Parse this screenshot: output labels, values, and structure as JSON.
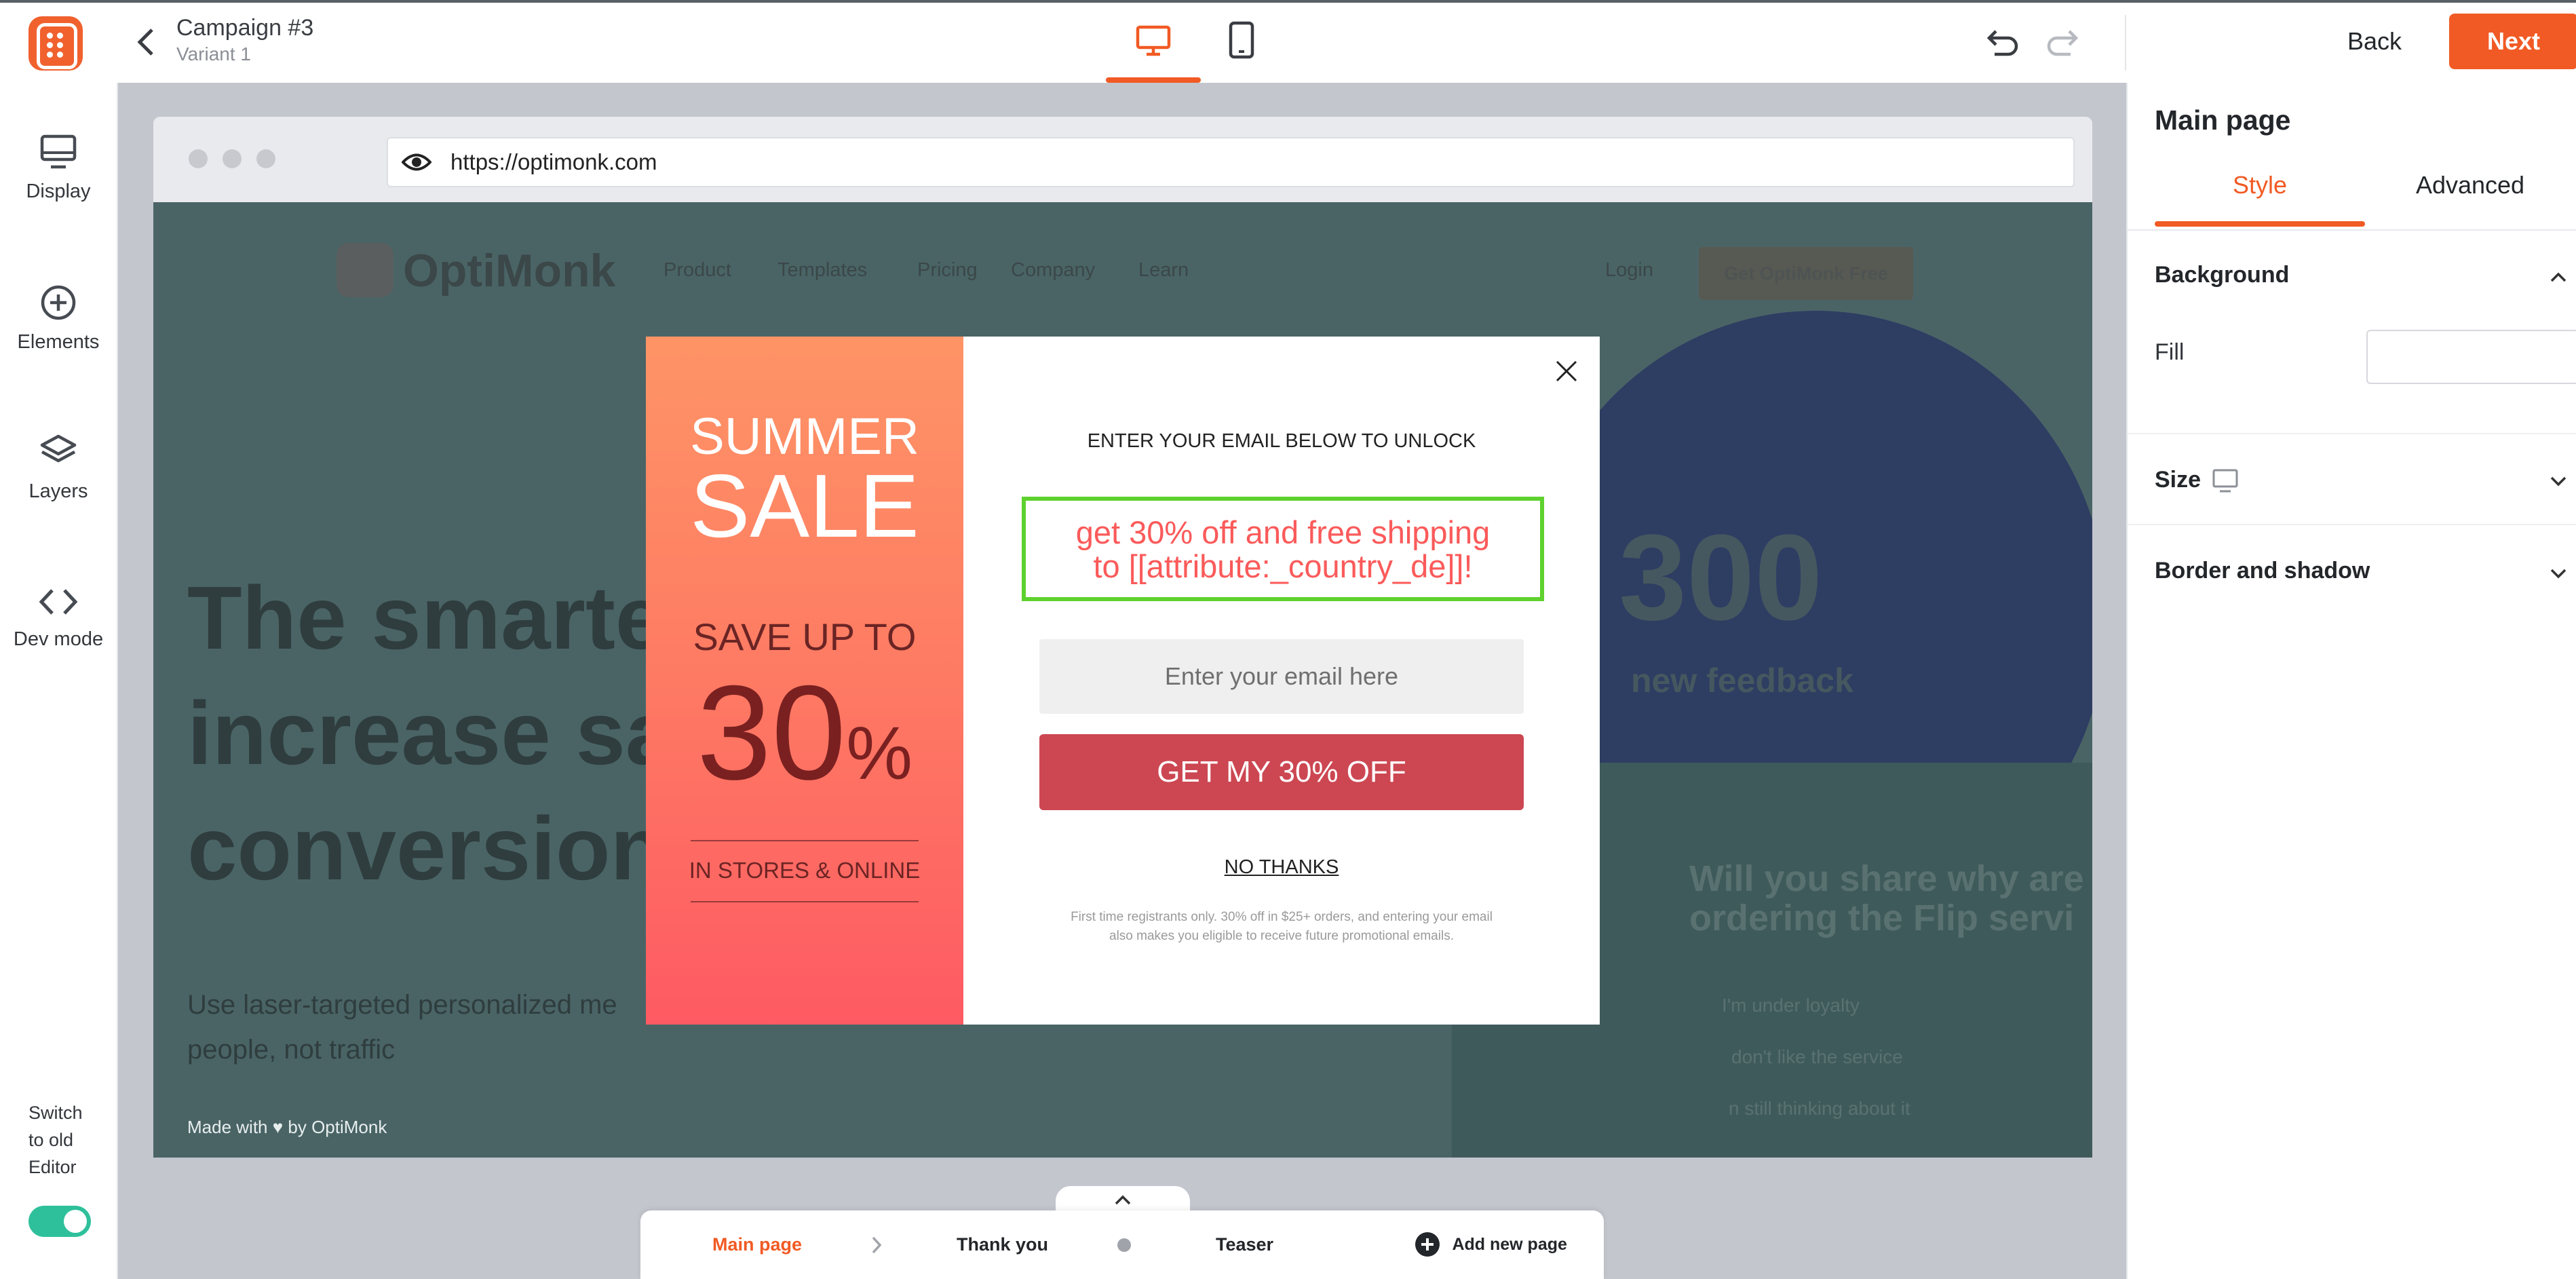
{
  "header": {
    "campaign_title": "Campaign #3",
    "variant": "Variant 1",
    "back_label": "Back",
    "next_label": "Next",
    "accent": "#f15a24"
  },
  "left_nav": {
    "items": [
      {
        "label": "Display",
        "icon": "monitor-icon"
      },
      {
        "label": "Elements",
        "icon": "plus-circle-icon"
      },
      {
        "label": "Layers",
        "icon": "layers-icon"
      },
      {
        "label": "Dev mode",
        "icon": "code-icon"
      }
    ],
    "switch_label_1": "Switch",
    "switch_label_2": "to old",
    "switch_label_3": "Editor",
    "switch_on": true
  },
  "browser": {
    "url": "https://optimonk.com"
  },
  "site": {
    "brand": "OptiMonk",
    "nav": [
      "Product",
      "Templates",
      "Pricing",
      "Company",
      "Learn"
    ],
    "login": "Login",
    "cta": "Get OptiMonk Free",
    "hero_1": "The smarte",
    "hero_2": "increase sa",
    "hero_3": "conversion",
    "sub_1": "Use laser-targeted personalized me",
    "sub_2": "people, not traffic",
    "stat_number": "300",
    "stat_label": "new feedback",
    "survey_1": "Will you share why are",
    "survey_2": "ordering the Flip servi",
    "option_1": "I'm under loyalty",
    "option_2": "don't like the service",
    "option_3": "n still thinking about it",
    "made_with": "Made with ♥ by OptiMonk"
  },
  "popup": {
    "summer": "SUMMER",
    "sale": "SALE",
    "save_up_to": "SAVE UP TO",
    "percent_num": "30",
    "percent_sign": "%",
    "stores": "IN STORES & ONLINE",
    "headline": "ENTER YOUR EMAIL BELOW TO UNLOCK",
    "offer_1": "get 30% off and free shipping",
    "offer_2": "to [[attribute:_country_de]]!",
    "email_placeholder": "Enter your email here",
    "cta": "GET MY 30% OFF",
    "no_thanks": "NO THANKS",
    "fine_1": "First time registrants only. 30% off in $25+ orders, and entering your email",
    "fine_2": "also makes you eligible to receive future promotional emails."
  },
  "pages_bar": {
    "pages": [
      "Main page",
      "Thank you",
      "Teaser"
    ],
    "add_label": "Add new page"
  },
  "right_panel": {
    "title": "Main page",
    "tabs": [
      "Style",
      "Advanced"
    ],
    "active_tab": "Style",
    "sections": {
      "background": "Background",
      "fill": "Fill",
      "size": "Size",
      "border": "Border and shadow"
    }
  }
}
